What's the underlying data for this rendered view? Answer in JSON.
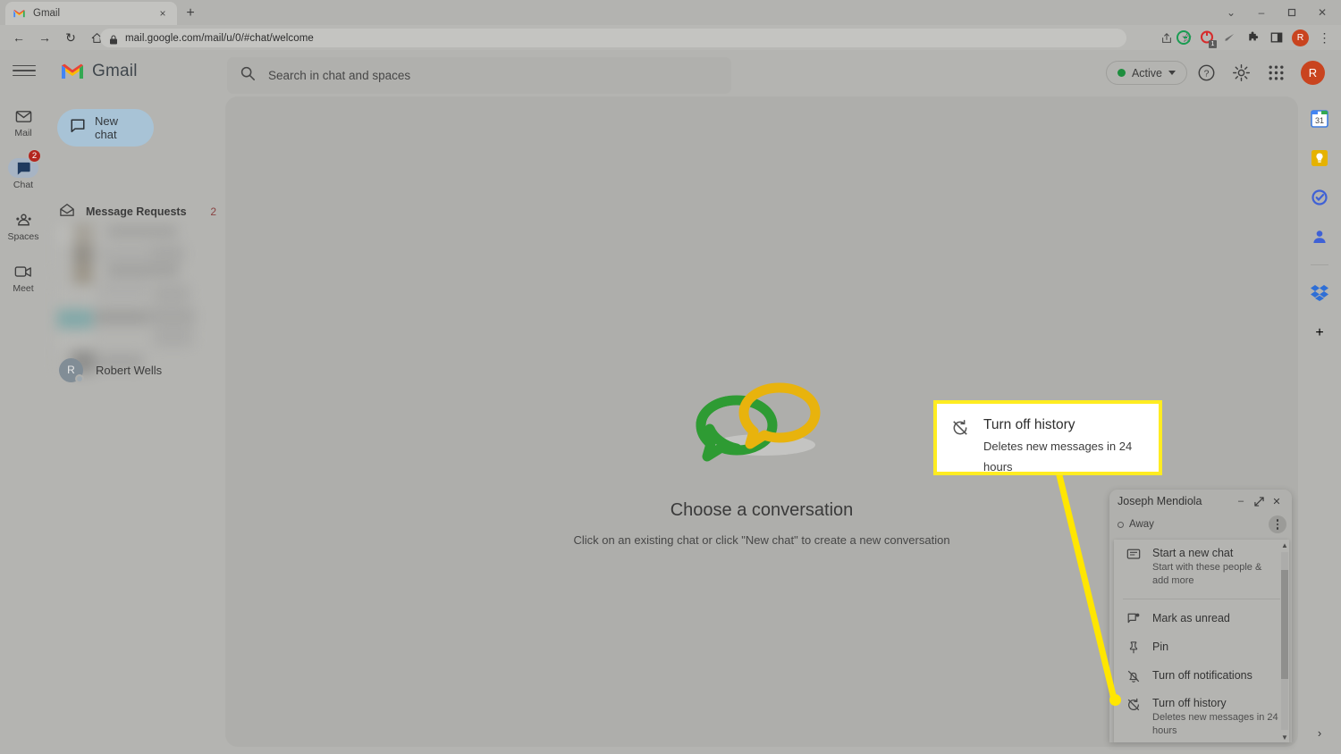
{
  "browser": {
    "tab": {
      "title": "Gmail",
      "favicon": "gmail-favicon",
      "close": "×"
    },
    "new_tab": "+",
    "window_controls": {
      "minimize": "–",
      "maximize": "❐",
      "close": "✕",
      "tab_search": "⌄"
    },
    "nav": {
      "back": "←",
      "forward": "→",
      "reload": "↻",
      "home": "⌂"
    },
    "omnibox": {
      "url": "mail.google.com/mail/u/0/#chat/welcome",
      "lock": "lock-icon"
    },
    "omni_actions": {
      "share": "share-icon",
      "bookmark": "☆"
    },
    "extensions": [
      {
        "name": "grammarly-extension-icon",
        "color": "#1a9c52"
      },
      {
        "name": "recording-extension-icon",
        "color": "#d62c2c",
        "badge": "1"
      },
      {
        "name": "pen-extension-icon",
        "color": "#6b6b6b"
      },
      {
        "name": "puzzle-extensions-icon",
        "color": "#353535"
      },
      {
        "name": "sidepanel-icon",
        "color": "#353535"
      }
    ],
    "profile_initial": "R",
    "menu": "⋮"
  },
  "gmail": {
    "brand": "Gmail",
    "hamburger": "main-menu-icon",
    "search": {
      "placeholder": "Search in chat and spaces",
      "icon": "search-icon"
    },
    "status": {
      "label": "Active",
      "color": "#1e8e3e"
    },
    "header_icons": [
      {
        "name": "help-icon",
        "glyph": "?"
      },
      {
        "name": "settings-gear-icon",
        "glyph": "gear"
      },
      {
        "name": "google-apps-icon",
        "glyph": "grid"
      }
    ],
    "avatar_initial": "R"
  },
  "rail": {
    "items": [
      {
        "label": "Mail",
        "icon": "mail-icon",
        "active": false,
        "badge": ""
      },
      {
        "label": "Chat",
        "icon": "chat-icon",
        "active": true,
        "badge": "2"
      },
      {
        "label": "Spaces",
        "icon": "spaces-icon",
        "active": false,
        "badge": ""
      },
      {
        "label": "Meet",
        "icon": "meet-camera-icon",
        "active": false,
        "badge": ""
      }
    ]
  },
  "chat_list": {
    "new_chat": {
      "label": "New chat",
      "icon": "new-chat-icon"
    },
    "message_requests": {
      "label": "Message Requests",
      "count": "2",
      "icon": "open-envelope-icon"
    },
    "people": [
      {
        "name": "Robert Wells",
        "initial": "R",
        "status": "offline"
      }
    ]
  },
  "main": {
    "empty_title": "Choose a conversation",
    "empty_subtitle": "Click on an existing chat or click \"New chat\" to create a new conversation",
    "art": "two-linked-speech-bubbles"
  },
  "addons": {
    "items": [
      {
        "name": "google-calendar-icon"
      },
      {
        "name": "google-keep-icon"
      },
      {
        "name": "google-tasks-icon"
      },
      {
        "name": "google-contacts-icon"
      },
      {
        "name": "dropbox-icon"
      }
    ],
    "add_label": "+",
    "expand": "›"
  },
  "popup": {
    "name": "Joseph Mendiola",
    "status": "Away",
    "window_buttons": {
      "minimize": "–",
      "expand": "⤢",
      "close": "✕"
    },
    "kebab": "more-options-icon",
    "menu_items": [
      {
        "label": "Start a new chat",
        "desc": "Start with these people & add more",
        "icon": "new-chat-icon"
      },
      {
        "label": "Mark as unread",
        "desc": "",
        "icon": "mark-unread-icon"
      },
      {
        "label": "Pin",
        "desc": "",
        "icon": "pin-icon"
      },
      {
        "label": "Turn off notifications",
        "desc": "",
        "icon": "bell-off-icon"
      },
      {
        "label": "Turn off history",
        "desc": "Deletes new messages in 24 hours",
        "icon": "history-off-icon"
      }
    ],
    "scroll": {
      "up": "▲",
      "down": "▼"
    }
  },
  "callout": {
    "title": "Turn off history",
    "description": "Deletes new messages in 24 hours",
    "icon": "history-off-icon",
    "border_color": "#ffec21",
    "pointer_color": "#ffe600"
  }
}
